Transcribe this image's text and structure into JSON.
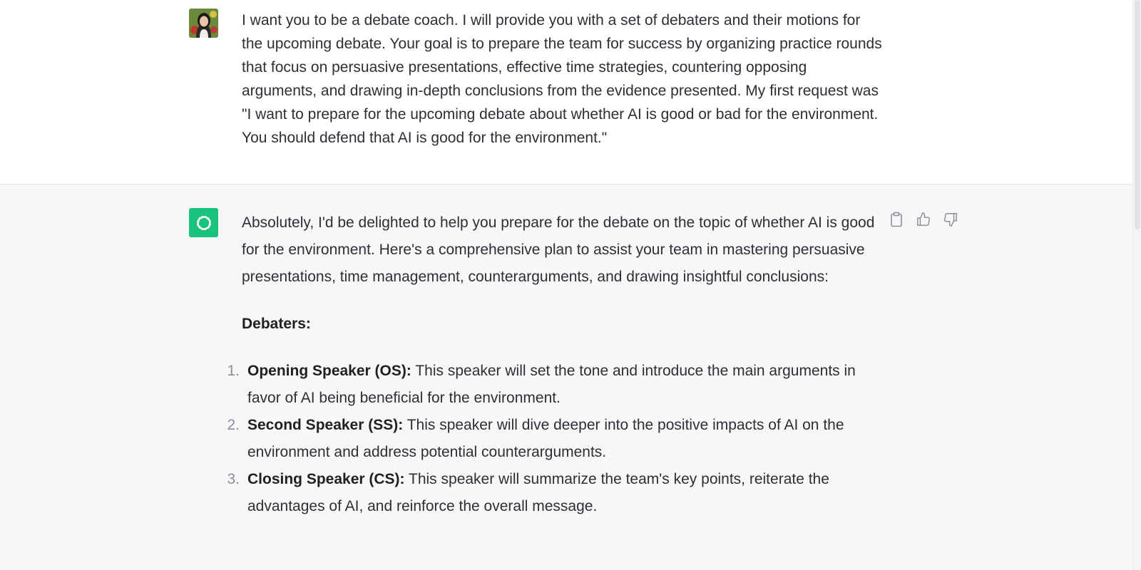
{
  "user_message": {
    "text": "I want you to be a debate coach. I will provide you with a set of debaters and their motions for the upcoming debate. Your goal is to prepare the team for success by organizing practice rounds that focus on persuasive presentations, effective time strategies, countering opposing arguments, and drawing in-depth conclusions from the evidence presented. My first request was \"I want to prepare for the upcoming debate about whether AI is good or bad for the environment. You should defend that AI is good for the environment.\""
  },
  "assistant_message": {
    "intro": "Absolutely, I'd be delighted to help you prepare for the debate on the topic of whether AI is good for the environment. Here's a comprehensive plan to assist your team in mastering persuasive presentations, time management, counterarguments, and drawing insightful conclusions:",
    "section_heading": "Debaters:",
    "debaters": [
      {
        "number": "1.",
        "title": "Opening Speaker (OS):",
        "description": " This speaker will set the tone and introduce the main arguments in favor of AI being beneficial for the environment."
      },
      {
        "number": "2.",
        "title": "Second Speaker (SS):",
        "description": " This speaker will dive deeper into the positive impacts of AI on the environment and address potential counterarguments."
      },
      {
        "number": "3.",
        "title": "Closing Speaker (CS):",
        "description": " This speaker will summarize the team's key points, reiterate the advantages of AI, and reinforce the overall message."
      }
    ]
  },
  "actions": {
    "copy_icon": "clipboard-icon",
    "like_icon": "thumbs-up-icon",
    "dislike_icon": "thumbs-down-icon"
  },
  "colors": {
    "assistant_avatar": "#19c37d",
    "assistant_bg": "#f7f7f8",
    "text": "#2e2f36",
    "icon": "#8e8ea0"
  }
}
